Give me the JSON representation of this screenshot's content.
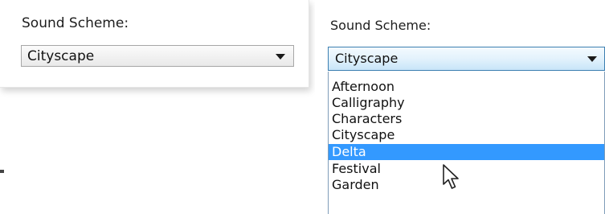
{
  "closed_combo": {
    "label": "Sound Scheme:",
    "value": "Cityscape"
  },
  "open_combo": {
    "label": "Sound Scheme:",
    "value": "Cityscape",
    "options": [
      "Afternoon",
      "Calligraphy",
      "Characters",
      "Cityscape",
      "Delta",
      "Festival",
      "Garden"
    ],
    "highlighted": "Delta"
  },
  "icons": {
    "dropdown_arrow": "chevron-down-icon",
    "cursor": "mouse-pointer-icon"
  },
  "colors": {
    "highlight": "#3399ff",
    "focus_border": "#3c7fb1"
  }
}
